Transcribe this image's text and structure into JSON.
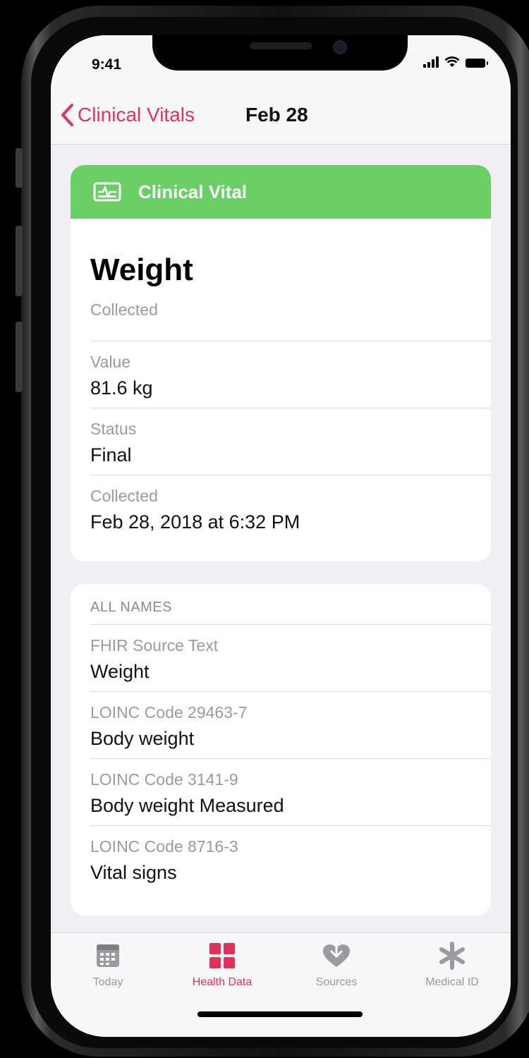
{
  "status_bar": {
    "time": "9:41"
  },
  "nav": {
    "back_label": "Clinical Vitals",
    "title": "Feb 28"
  },
  "record_card": {
    "header_label": "Clinical Vital",
    "title": "Weight",
    "subtitle": "Collected",
    "rows": [
      {
        "label": "Value",
        "value": "81.6 kg"
      },
      {
        "label": "Status",
        "value": "Final"
      },
      {
        "label": "Collected",
        "value": "Feb 28, 2018 at 6:32 PM"
      }
    ]
  },
  "names_card": {
    "section_title": "ALL NAMES",
    "rows": [
      {
        "label": "FHIR Source Text",
        "value": "Weight"
      },
      {
        "label": "LOINC Code 29463-7",
        "value": "Body weight"
      },
      {
        "label": "LOINC Code 3141-9",
        "value": "Body weight Measured"
      },
      {
        "label": "LOINC Code 8716-3",
        "value": "Vital signs"
      }
    ]
  },
  "tabbar": {
    "tabs": [
      {
        "label": "Today",
        "icon": "calendar-icon",
        "active": false
      },
      {
        "label": "Health Data",
        "icon": "grid-icon",
        "active": true
      },
      {
        "label": "Sources",
        "icon": "heart-download-icon",
        "active": false
      },
      {
        "label": "Medical ID",
        "icon": "asterisk-icon",
        "active": false
      }
    ]
  },
  "colors": {
    "accent": "#e0325a",
    "header_green": "#6bcf68",
    "inactive_tab": "#9a9aa0",
    "background": "#efeff4"
  }
}
